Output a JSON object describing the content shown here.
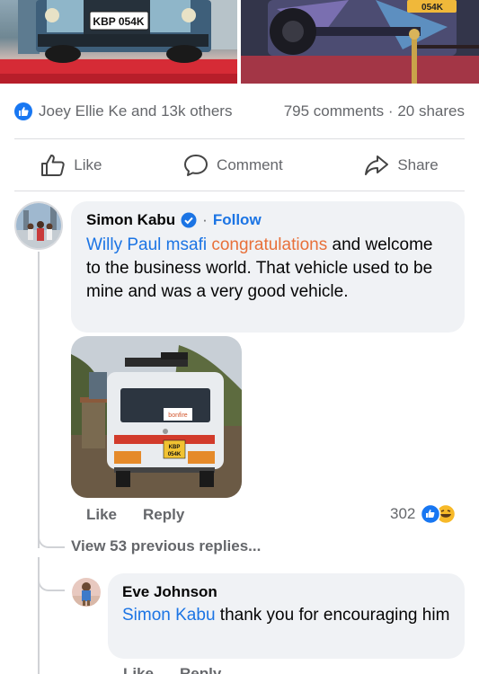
{
  "post": {
    "left_photo": {
      "plate": "KBP 054K"
    },
    "right_photo": {
      "plate": "054K"
    },
    "reactors_text": "Joey Ellie Ke and 13k others",
    "comments_text": "795 comments",
    "dot": "·",
    "shares_text": "20 shares"
  },
  "actions": {
    "like": "Like",
    "comment": "Comment",
    "share": "Share"
  },
  "comment": {
    "author": "Simon Kabu",
    "dot": "·",
    "follow": "Follow",
    "mention": "Willy Paul msafi",
    "highlight": "congratulations",
    "text_rest": " and welcome to the business world. That vehicle used to be mine and was a very good vehicle.",
    "photo": {
      "sign": "bonfire",
      "plate_line1": "KBP",
      "plate_line2": "054K"
    },
    "like": "Like",
    "reply": "Reply",
    "reaction_count": "302",
    "view_replies": "View 53 previous replies..."
  },
  "reply": {
    "author": "Eve Johnson",
    "mention": "Simon Kabu",
    "text_rest": " thank you for encouraging him",
    "like": "Like",
    "reply": "Reply"
  },
  "colors": {
    "facebook_blue": "#1b74e4",
    "orange_highlight": "#e8703a",
    "bubble": "#f0f2f5",
    "muted": "#65676b"
  }
}
